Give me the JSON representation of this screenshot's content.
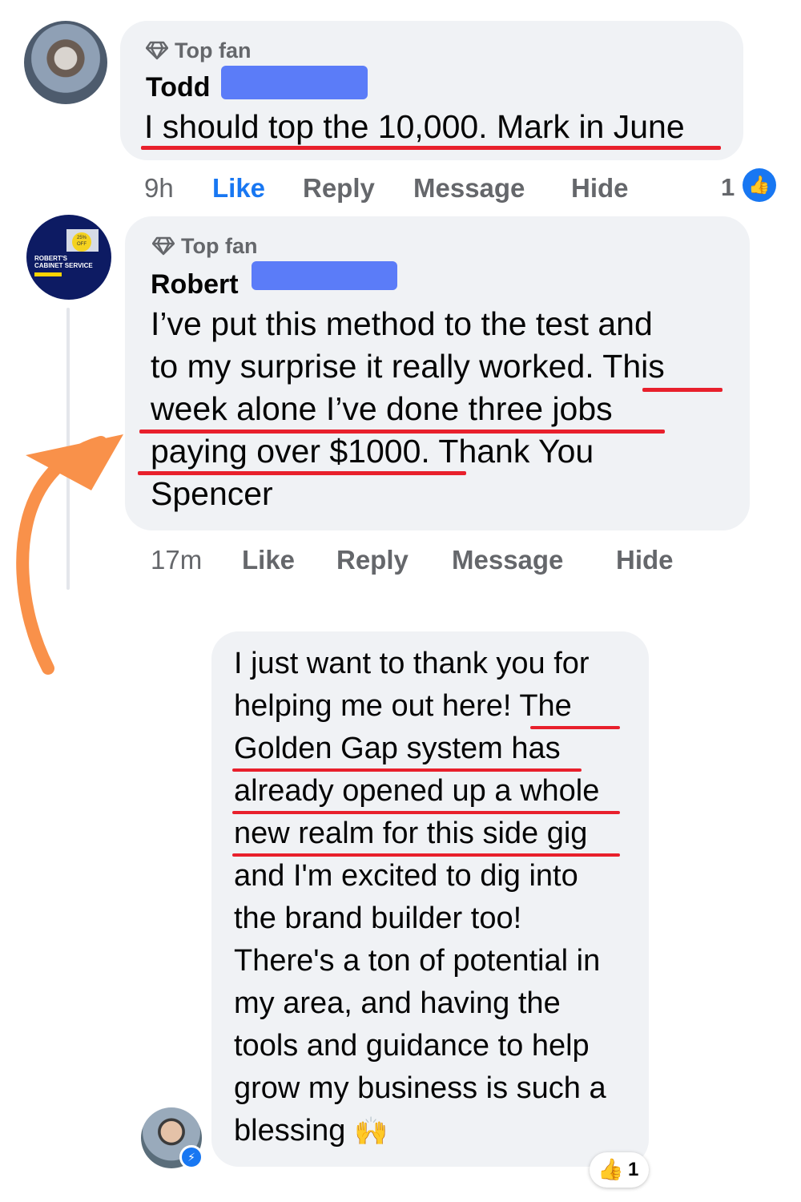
{
  "comments": [
    {
      "badge": "Top fan",
      "author_first": "Todd",
      "text_lines": [
        "I should top the 10,000. Mark in June"
      ],
      "time": "9h",
      "actions": {
        "like": "Like",
        "reply": "Reply",
        "message": "Message",
        "hide": "Hide"
      },
      "reaction_count": "1",
      "like_color": "#1877f2"
    },
    {
      "badge": "Top fan",
      "author_first": "Robert",
      "avatar_text": [
        "ROBERT'S",
        "CABINET SERVICE"
      ],
      "text_lines": [
        "I’ve put this method to the test and",
        "to my surprise it really worked. This",
        "week alone I’ve done three jobs",
        "paying over $1000. Thank You",
        "Spencer"
      ],
      "time": "17m",
      "actions": {
        "like": "Like",
        "reply": "Reply",
        "message": "Message",
        "hide": "Hide"
      }
    }
  ],
  "message": {
    "lines": [
      "I just want to thank you for",
      "helping me out here! The",
      "Golden Gap system has",
      "already opened up a whole",
      "new realm for this side gig",
      "and I'm excited to dig into",
      "the brand builder too!",
      "There's a ton of potential in",
      "my area, and having the",
      "tools and guidance to help",
      "grow my business is such a",
      "blessing"
    ],
    "end_emoji": "🙌",
    "reaction_emoji": "👍",
    "reaction_count": "1"
  },
  "colors": {
    "bubble": "#f0f2f5",
    "underline": "#e8202c",
    "redaction": "#5b7cf8",
    "arrow": "#f9914a",
    "accent": "#1877f2"
  },
  "icons": [
    "diamond-icon",
    "thumbs-up-icon",
    "messenger-icon",
    "raised-hands-emoji",
    "orange-arrow"
  ]
}
